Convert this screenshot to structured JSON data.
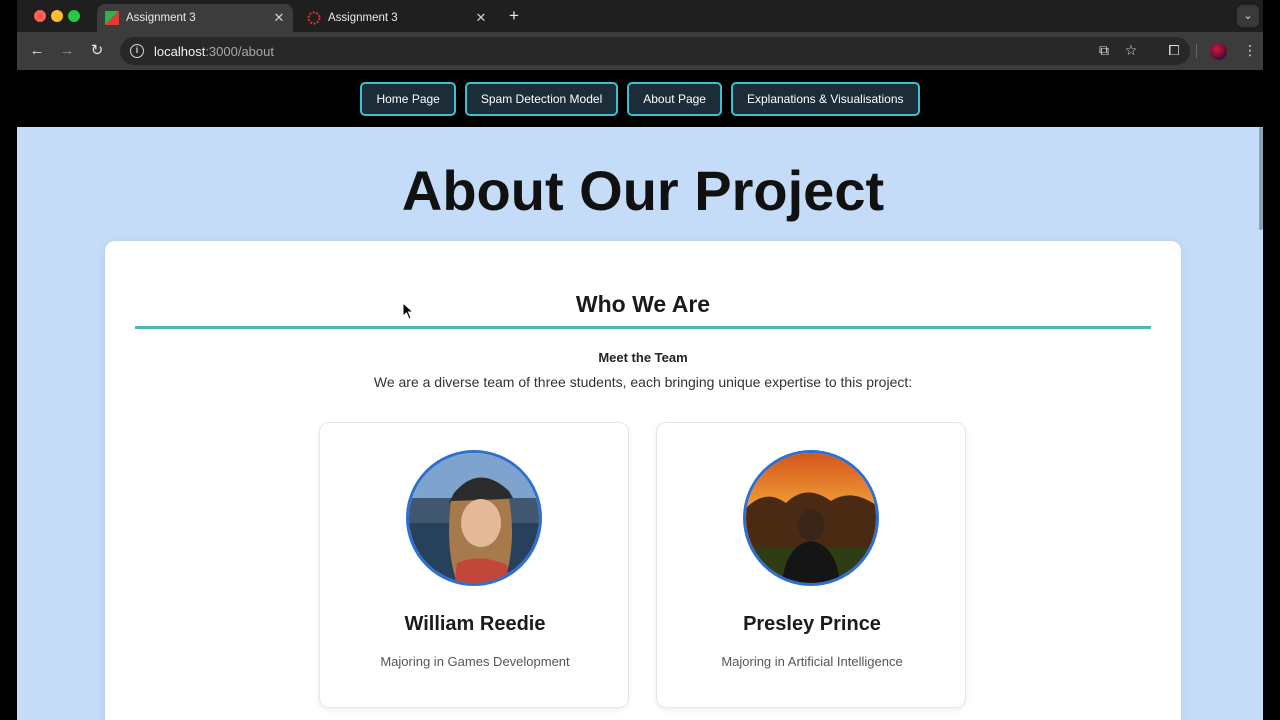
{
  "browser": {
    "tabs": [
      {
        "title": "Assignment 3",
        "active": true,
        "favicon": "brand-favicon-icon"
      },
      {
        "title": "Assignment 3",
        "active": false,
        "favicon": "red-spinner-favicon-icon"
      }
    ],
    "url_host": "localhost",
    "url_path": ":3000/about"
  },
  "nav": {
    "links": [
      {
        "label": "Home Page"
      },
      {
        "label": "Spam Detection Model"
      },
      {
        "label": "About Page"
      },
      {
        "label": "Explanations & Visualisations"
      }
    ]
  },
  "page": {
    "title": "About Our Project",
    "section_heading": "Who We Are",
    "team_heading": "Meet the Team",
    "intro": "We are a diverse team of three students, each bringing unique expertise to this project:",
    "members": [
      {
        "name": "William Reedie",
        "major": "Majoring in Games Development"
      },
      {
        "name": "Presley Prince",
        "major": "Majoring in Artificial Intelligence"
      }
    ]
  },
  "colors": {
    "page_background": "#c4dcf7",
    "nav_border": "#3ac1cf",
    "divider": "#4db6ae",
    "photo_border": "#2f6fd0"
  }
}
